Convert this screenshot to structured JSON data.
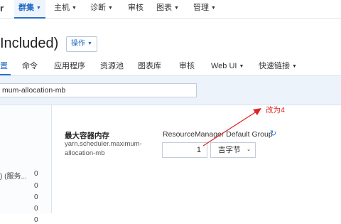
{
  "nav": {
    "brand": "r",
    "items": [
      {
        "label": "群集",
        "active": true,
        "dropdown": true
      },
      {
        "label": "主机",
        "dropdown": true
      },
      {
        "label": "诊断",
        "dropdown": true
      },
      {
        "label": "审核",
        "dropdown": false
      },
      {
        "label": "图表",
        "dropdown": true
      },
      {
        "label": "管理",
        "dropdown": true
      }
    ]
  },
  "page": {
    "title": " Included)",
    "action_button": "操作"
  },
  "tabs": [
    {
      "label": "置",
      "active": true
    },
    {
      "label": "命令"
    },
    {
      "label": "应用程序"
    },
    {
      "label": "资源池"
    },
    {
      "label": "图表库"
    },
    {
      "label": "审核"
    },
    {
      "label": "Web UI",
      "dropdown": true
    },
    {
      "label": "快速链接",
      "dropdown": true
    }
  ],
  "search": {
    "value": "mum-allocation-mb"
  },
  "filters": {
    "label": ") (服务...",
    "counts": [
      "0",
      "0",
      "0",
      "0",
      "0"
    ]
  },
  "config": {
    "label": "最大容器内存",
    "key": "yarn.scheduler.maximum-allocation-mb",
    "group": "ResourceManager Default Group",
    "value": "1",
    "unit": "吉字节",
    "revert_icon": "undo-icon"
  },
  "annotation": {
    "text": "改为4",
    "color": "#e02424"
  },
  "colors": {
    "accent": "#2c73d2",
    "band": "#edf3fb"
  }
}
